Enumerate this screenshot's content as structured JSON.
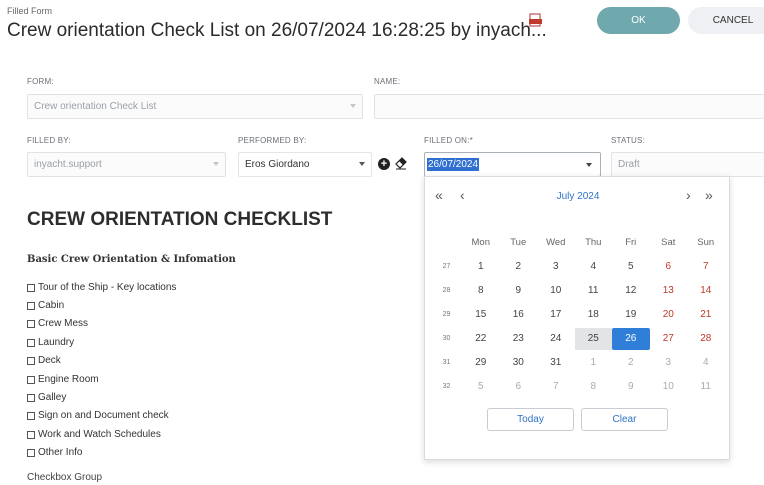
{
  "header": {
    "caption": "Filled Form",
    "title": "Crew orientation Check List on 26/07/2024 16:28:25 by inyach...",
    "ok_label": "OK",
    "cancel_label": "CANCEL"
  },
  "form": {
    "form_label": "FORM:",
    "form_value": "Crew orientation Check List",
    "name_label": "NAME:",
    "name_value": "",
    "filled_by_label": "FILLED BY:",
    "filled_by_value": "inyacht.support",
    "performed_by_label": "PERFORMED BY:",
    "performed_by_value": "Eros Giordano",
    "filled_on_label": "FILLED ON:*",
    "filled_on_value": "26/07/2024",
    "status_label": "STATUS:",
    "status_value": "Draft"
  },
  "checklist": {
    "heading": "CREW ORIENTATION CHECKLIST",
    "subheading": "Basic Crew Orientation & Infomation",
    "items": [
      "Tour of the Ship - Key locations",
      "Cabin",
      "Crew Mess",
      "Laundry",
      "Deck",
      "Engine Room",
      "Galley",
      "Sign on and Document check",
      "Work and Watch Schedules",
      "Other Info"
    ],
    "group_label": "Checkbox Group"
  },
  "calendar": {
    "month_label": "July 2024",
    "nav": {
      "prev_year": "«",
      "prev_month": "‹",
      "next_month": "›",
      "next_year": "»"
    },
    "weekdays": [
      "Mon",
      "Tue",
      "Wed",
      "Thu",
      "Fri",
      "Sat",
      "Sun"
    ],
    "weeks": [
      {
        "week": "27",
        "days": [
          "1",
          "2",
          "3",
          "4",
          "5",
          "6",
          "7"
        ]
      },
      {
        "week": "28",
        "days": [
          "8",
          "9",
          "10",
          "11",
          "12",
          "13",
          "14"
        ]
      },
      {
        "week": "29",
        "days": [
          "15",
          "16",
          "17",
          "18",
          "19",
          "20",
          "21"
        ]
      },
      {
        "week": "30",
        "days": [
          "22",
          "23",
          "24",
          "25",
          "26",
          "27",
          "28"
        ]
      },
      {
        "week": "31",
        "days": [
          "29",
          "30",
          "31",
          "1",
          "2",
          "3",
          "4"
        ]
      },
      {
        "week": "32",
        "days": [
          "5",
          "6",
          "7",
          "8",
          "9",
          "10",
          "11"
        ]
      }
    ],
    "today_day": "25",
    "selected_day": "26",
    "today_label": "Today",
    "clear_label": "Clear"
  },
  "colors": {
    "accent": "#2f7ed8",
    "ok_button": "#6fa8ad",
    "weekend": "#c0392b"
  }
}
